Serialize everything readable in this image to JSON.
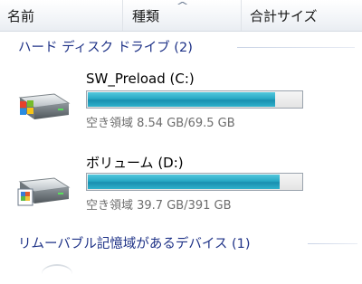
{
  "columns": {
    "name": "名前",
    "type": "種類",
    "total_size": "合計サイズ"
  },
  "groups": {
    "hard_disk": "ハード ディスク ドライブ (2)",
    "removable": "リムーバブル記憶域があるデバイス (1)"
  },
  "drives": [
    {
      "name": "SW_Preload (C:)",
      "free_text": "空き領域 8.54 GB/69.5 GB",
      "used_fraction": 0.877,
      "icon": "windows-drive-icon"
    },
    {
      "name": "ボリューム (D:)",
      "free_text": "空き領域 39.7 GB/391 GB",
      "used_fraction": 0.898,
      "icon": "data-drive-icon"
    }
  ],
  "colors": {
    "group_heading": "#1e3287",
    "bar_fill": "#27a8c4"
  }
}
